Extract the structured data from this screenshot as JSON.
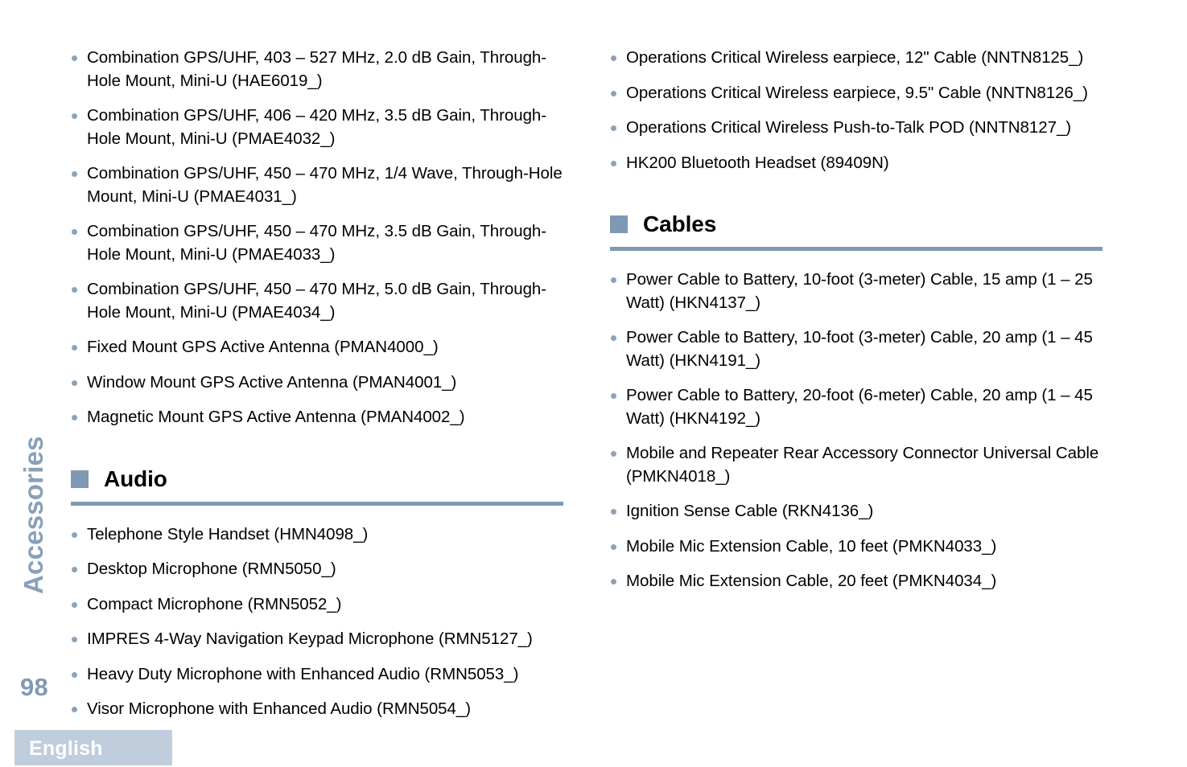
{
  "colors": {
    "accent": "#7f99b4",
    "bullet": "#8ba3ba",
    "chapter_text": "#88a0b8",
    "page_number": "#8199b4",
    "tab_background": "#bfcddc",
    "tab_text": "#ffffff",
    "body_text": "#000000",
    "page_background": "#ffffff"
  },
  "sidebar": {
    "chapter_label": "Accessories",
    "page_number": "98",
    "language_tab": "English"
  },
  "left_column": {
    "antenna_items": [
      "Combination GPS/UHF, 403 – 527 MHz, 2.0 dB Gain, Through-Hole Mount, Mini-U (HAE6019_)",
      "Combination GPS/UHF, 406 – 420 MHz, 3.5 dB Gain, Through-Hole Mount, Mini-U (PMAE4032_)",
      "Combination GPS/UHF, 450 – 470 MHz, 1/4 Wave, Through-Hole Mount, Mini-U (PMAE4031_)",
      "Combination GPS/UHF, 450 – 470 MHz, 3.5 dB Gain, Through-Hole Mount, Mini-U (PMAE4033_)",
      "Combination GPS/UHF, 450 – 470 MHz, 5.0 dB Gain, Through-Hole Mount, Mini-U (PMAE4034_)",
      "Fixed Mount GPS Active Antenna (PMAN4000_)",
      "Window Mount GPS Active Antenna (PMAN4001_)",
      "Magnetic Mount GPS Active Antenna (PMAN4002_)"
    ],
    "audio_section": {
      "title": "Audio",
      "marker": "square-marker-icon",
      "items": [
        "Telephone Style Handset (HMN4098_)",
        "Desktop Microphone (RMN5050_)",
        "Compact Microphone (RMN5052_)",
        "IMPRES 4-Way Navigation Keypad Microphone (RMN5127_)",
        "Heavy Duty Microphone with Enhanced Audio (RMN5053_)",
        "Visor Microphone with Enhanced Audio (RMN5054_)"
      ]
    }
  },
  "right_column": {
    "wireless_items": [
      "Operations Critical Wireless earpiece, 12\" Cable (NNTN8125_)",
      "Operations Critical Wireless earpiece, 9.5\" Cable (NNTN8126_)",
      "Operations Critical Wireless Push-to-Talk POD (NNTN8127_)",
      "HK200 Bluetooth Headset (89409N)"
    ],
    "cables_section": {
      "title": "Cables",
      "marker": "square-marker-icon",
      "items": [
        "Power Cable to Battery, 10-foot (3-meter) Cable, 15 amp (1 – 25 Watt) (HKN4137_)",
        "Power Cable to Battery, 10-foot (3-meter) Cable, 20 amp (1 – 45 Watt) (HKN4191_)",
        "Power Cable to Battery, 20-foot (6-meter) Cable, 20 amp (1 – 45 Watt) (HKN4192_)",
        "Mobile and Repeater Rear Accessory Connector Universal Cable (PMKN4018_)",
        "Ignition Sense Cable (RKN4136_)",
        "Mobile Mic Extension Cable, 10 feet (PMKN4033_)",
        "Mobile Mic Extension Cable, 20 feet (PMKN4034_)"
      ]
    }
  }
}
